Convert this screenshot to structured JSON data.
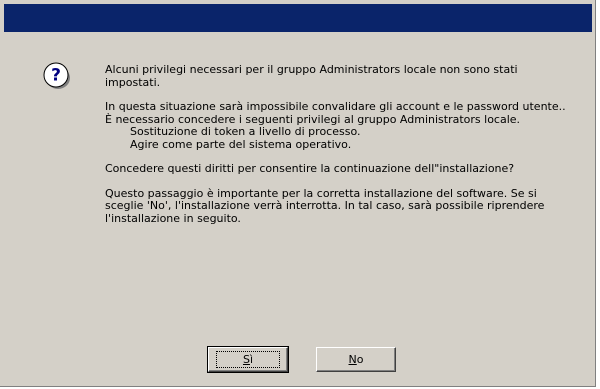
{
  "dialog": {
    "title": "",
    "icon": "question-icon",
    "accent_color": "#0a246a",
    "message": {
      "p1": "Alcuni privilegi necessari per il gruppo Administrators locale non sono stati impostati.",
      "p2": "In questa situazione sarà impossibile convalidare gli account e le password utente..",
      "p3": "È necessario concedere i seguenti privilegi al gruppo Administrators locale.",
      "priv1": "Sostituzione di token a livello di processo.",
      "priv2": "Agire come parte del sistema operativo.",
      "p4": "Concedere questi diritti per consentire la continuazione dell\"installazione?",
      "p5": "Questo passaggio è importante per la corretta installazione del software. Se si sceglie 'No', l'installazione verrà interrotta. In tal caso, sarà possibile riprendere l'installazione in seguito."
    },
    "buttons": {
      "yes_accel": "S",
      "yes_rest": "ì",
      "no_accel": "N",
      "no_rest": "o"
    }
  }
}
